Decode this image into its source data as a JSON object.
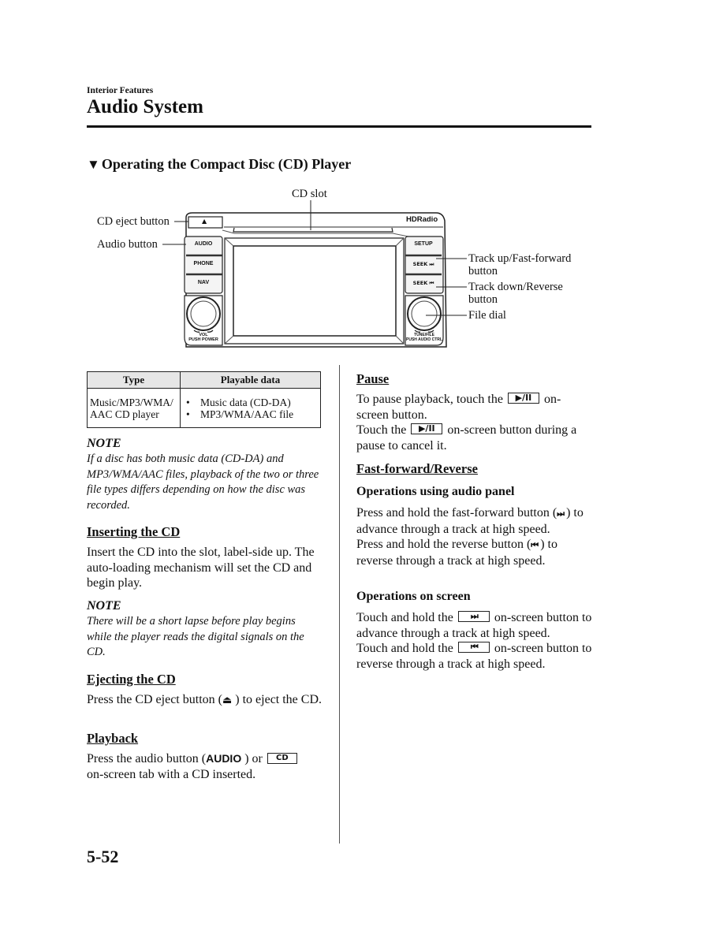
{
  "header": {
    "section_label": "Interior Features",
    "page_title": "Audio System"
  },
  "subsection": {
    "marker_icon": "down-triangle",
    "title": "Operating the Compact Disc (CD) Player"
  },
  "figure": {
    "labels": {
      "cd_slot": "CD slot",
      "cd_eject_button": "CD eject button",
      "audio_button": "Audio button",
      "track_up": [
        "Track up/Fast-forward",
        "button"
      ],
      "track_down": [
        "Track down/Reverse",
        "button"
      ],
      "file_dial": "File dial"
    },
    "unit": {
      "brand_logo": "HD Radio",
      "brand_logo_prefix": "HD",
      "brand_logo_suffix": "Radio",
      "eject_glyph": "▲",
      "left_buttons": [
        "AUDIO",
        "PHONE",
        "NAV"
      ],
      "right_buttons": [
        "SETUP",
        "SEEK ⏭",
        "SEEK ⏮"
      ],
      "left_knob_label": [
        "VOL",
        "PUSH POWER"
      ],
      "right_knob_label": [
        "TUNE/FILE",
        "PUSH AUDIO CTRL"
      ]
    }
  },
  "table": {
    "headers": [
      "Type",
      "Playable data"
    ],
    "rows": [
      {
        "type": [
          "Music/MP3/WMA/",
          "AAC CD player"
        ],
        "playable": [
          "Music data (CD-DA)",
          "MP3/WMA/AAC file"
        ]
      }
    ]
  },
  "left_column": {
    "note1": {
      "heading": "NOTE",
      "text": "If a disc has both music data (CD-DA) and MP3/WMA/AAC files, playback of the two or three file types differs depending on how the disc was recorded."
    },
    "inserting": {
      "heading": "Inserting the CD",
      "text": "Insert the CD into the slot, label-side up. The auto-loading mechanism will set the CD and begin play."
    },
    "note2": {
      "heading": "NOTE",
      "text": "There will be a short lapse before play begins while the player reads the digital signals on the CD."
    },
    "ejecting": {
      "heading": "Ejecting the CD",
      "text_before": "Press the CD eject button (",
      "glyph": "⏏",
      "text_after": " ) to eject the CD."
    },
    "playback": {
      "heading": "Playback",
      "text_before": "Press the audio button (",
      "audio_glyph": "AUDIO",
      "text_middle": " ) or ",
      "tab_label": "CD",
      "text_after": "on-screen tab with a CD inserted."
    }
  },
  "right_column": {
    "pause": {
      "heading": "Pause",
      "line1_before": "To pause playback, touch the ",
      "button_glyph": "▶/II",
      "line1_after": " on-screen button.",
      "line2_before": "Touch the ",
      "line2_after": " on-screen button during a pause to cancel it."
    },
    "ff_rev": {
      "heading": "Fast-forward/Reverse",
      "panel": {
        "subheading": "Operations using audio panel",
        "ff_before": "Press and hold the fast-forward button (",
        "ff_glyph": "⏭",
        "ff_after": " ) to advance through a track at high speed.",
        "rev_before": "Press and hold the reverse button (",
        "rev_glyph": "⏮",
        "rev_after": " ) to reverse through a track at high speed."
      },
      "screen": {
        "subheading": "Operations on screen",
        "ff_before": "Touch and hold the ",
        "ff_glyph": "⏭",
        "ff_after": " on-screen button to advance through a track at high speed.",
        "rev_before": "Touch and hold the ",
        "rev_glyph": "⏮",
        "rev_after": " on-screen button to reverse through a track at high speed."
      }
    }
  },
  "footer": {
    "page_number": "5-52"
  }
}
